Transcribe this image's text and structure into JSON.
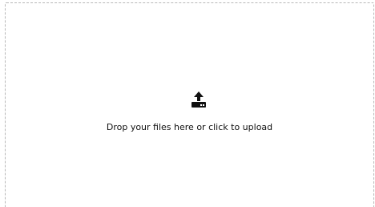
{
  "dropzone": {
    "icon": "upload-icon",
    "message": "Drop your files here or click to upload",
    "colors": {
      "border": "#b8b8b8",
      "icon": "#111111",
      "text": "#111111",
      "background": "#ffffff"
    }
  }
}
